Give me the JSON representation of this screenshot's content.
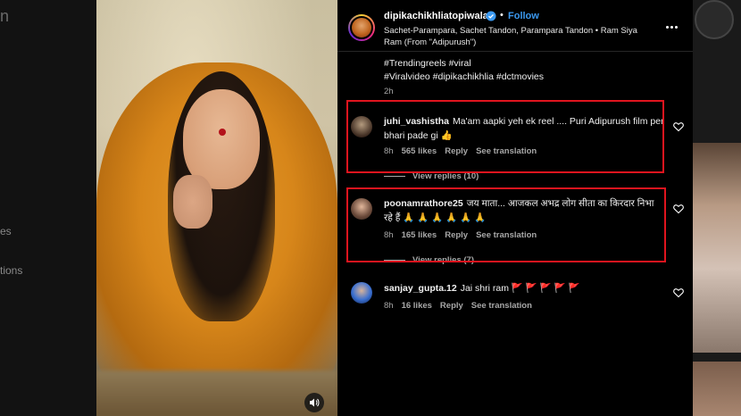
{
  "sidebar_ghost": {
    "top_glyph": "n",
    "item_a": "es",
    "item_b": "tions"
  },
  "post": {
    "username": "dipikachikhliatopiwala",
    "follow_label": "Follow",
    "audio_line": "Sachet-Parampara, Sachet Tandon, Parampara Tandon • Ram Siya Ram (From \"Adipurush\")",
    "caption_line1": "#Trendingreels #viral",
    "caption_line2": "#Viralvideo #dipikachikhlia #dctmovies",
    "caption_time": "2h"
  },
  "comments": [
    {
      "username": "juhi_vashistha",
      "text": "Ma'am aapki yeh ek reel .... Puri Adipurush film per bhari pade gi 👍",
      "time": "8h",
      "likes": "565 likes",
      "reply": "Reply",
      "translate": "See translation",
      "view_replies": "View replies (10)"
    },
    {
      "username": "poonamrathore25",
      "text": "जय माता... आजकल अभद्र लोग सीता का किरदार निभा रहे हैं 🙏 🙏 🙏 🙏 🙏 🙏",
      "time": "8h",
      "likes": "165 likes",
      "reply": "Reply",
      "translate": "See translation",
      "view_replies": "View replies (7)"
    },
    {
      "username": "sanjay_gupta.12",
      "text": "Jai shri ram 🚩 🚩 🚩 🚩 🚩",
      "time": "8h",
      "likes": "16 likes",
      "reply": "Reply",
      "translate": "See translation"
    }
  ],
  "colors": {
    "follow_blue": "#3b99f0",
    "highlight_red": "#e0141e",
    "panel_bg": "#000000"
  },
  "icons": {
    "verified": "verified-badge-icon",
    "more": "more-options-icon",
    "like": "heart-icon",
    "sound": "speaker-icon"
  }
}
